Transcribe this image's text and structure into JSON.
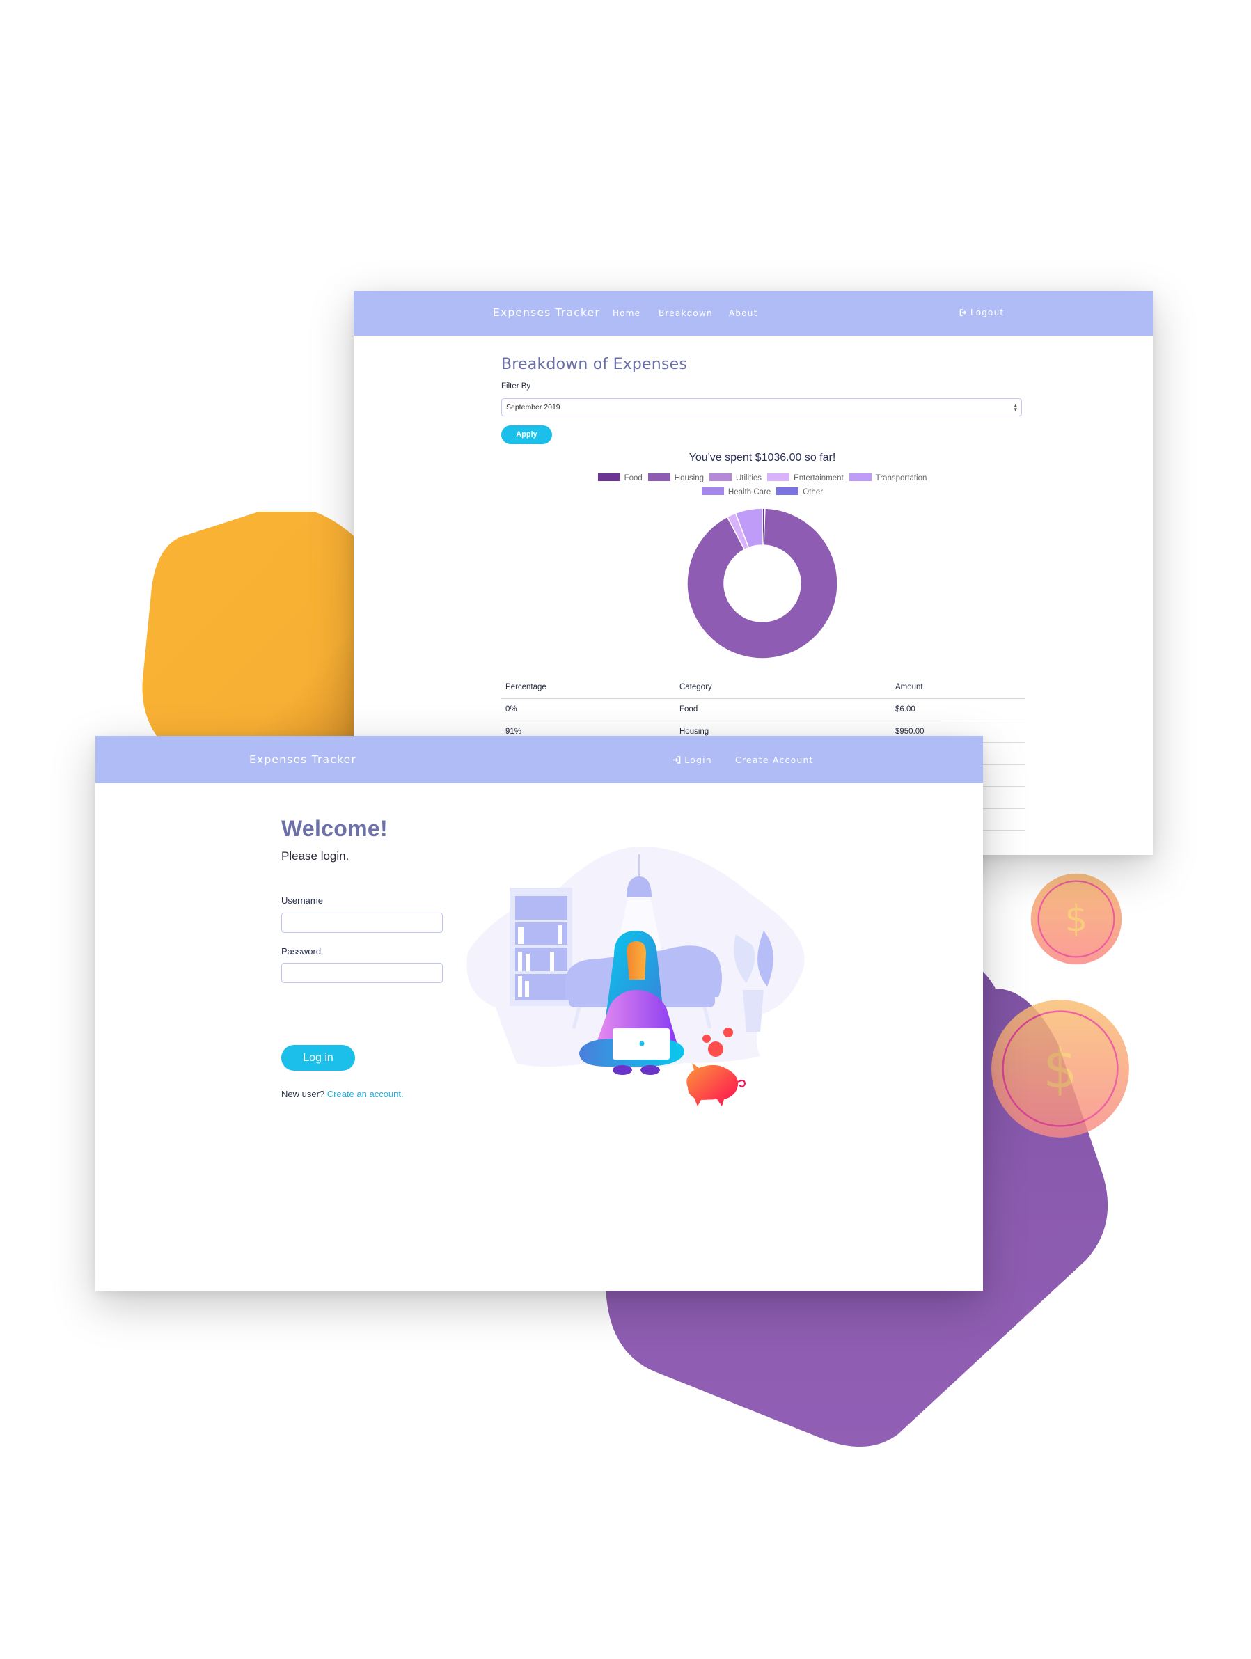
{
  "colors": {
    "navbar": "#afbcf5",
    "accent_button": "#1cbfe9",
    "heading": "#6e70a8",
    "yellow_shape": "#fbb335",
    "purple_shape": "#8e5cb2"
  },
  "breakdown_app": {
    "navbar": {
      "brand": "Expenses Tracker",
      "links": [
        "Home",
        "Breakdown",
        "About"
      ],
      "logout_icon": "sign-out-icon",
      "logout_label": "Logout"
    },
    "title": "Breakdown of Expenses",
    "filter_label": "Filter By",
    "filter_selected": "September 2019",
    "apply_label": "Apply",
    "spent_text": "You've spent $1036.00 so far!",
    "table": {
      "headers": [
        "Percentage",
        "Category",
        "Amount"
      ],
      "rows": [
        {
          "percentage": "0%",
          "category": "Food",
          "amount": "$6.00"
        },
        {
          "percentage": "91%",
          "category": "Housing",
          "amount": "$950.00"
        }
      ]
    }
  },
  "chart_data": {
    "type": "pie",
    "variant": "doughnut",
    "title": "",
    "categories": [
      "Food",
      "Housing",
      "Utilities",
      "Entertainment",
      "Transportation",
      "Health Care",
      "Other"
    ],
    "values": [
      6,
      950,
      0,
      20,
      60,
      0,
      0
    ],
    "colors": [
      "#6c3593",
      "#8e5cb2",
      "#b48ad6",
      "#d8b3fb",
      "#bf9cf7",
      "#a487ea",
      "#7a73e0"
    ],
    "total": 1036,
    "legend": "top"
  },
  "login_app": {
    "navbar": {
      "brand": "Expenses Tracker",
      "login_icon": "sign-in-icon",
      "login_label": "Login",
      "create_account_label": "Create Account"
    },
    "welcome": "Welcome!",
    "subtitle": "Please login.",
    "username_label": "Username",
    "username_value": "",
    "password_label": "Password",
    "password_value": "",
    "login_button": "Log in",
    "new_user_text": "New user?",
    "create_link": "Create an account."
  },
  "decor": {
    "coin_icon": "dollar-coin-icon",
    "coin_symbol": "$"
  }
}
